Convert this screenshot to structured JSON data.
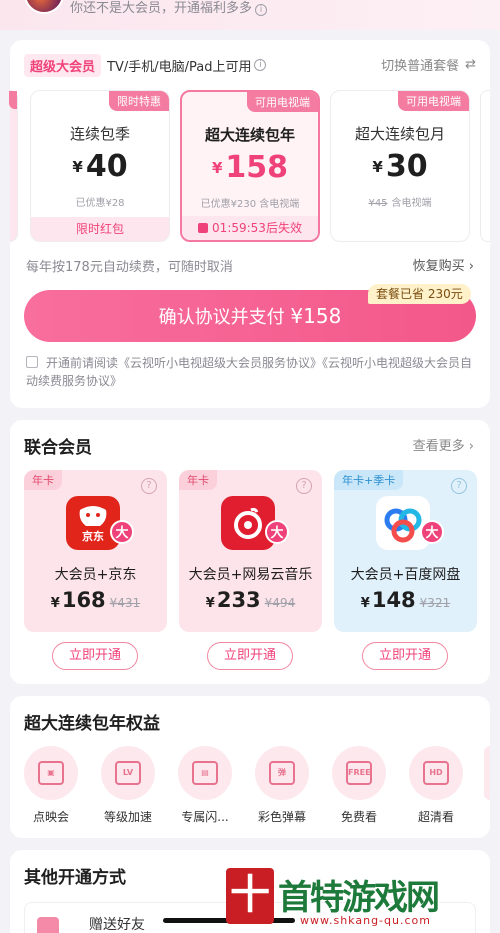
{
  "header": {
    "promo_text": "你还不是大会员，开通福利多多",
    "info_icon": "ⓘ"
  },
  "packages": {
    "svip_tag": "超级大会员",
    "devices_text": "TV/手机/电脑/Pad上可用",
    "info_icon": "ⓘ",
    "switch_label": "切换普通套餐",
    "switch_icon": "⇄",
    "plans": [
      {
        "badge": "限时特惠",
        "name": "连续包季",
        "currency": "¥",
        "price": "40",
        "sub": "已优惠¥28",
        "sub_strike": "",
        "footer": "限时红包",
        "selected": false
      },
      {
        "badge": "可用电视端",
        "name": "超大连续包年",
        "currency": "¥",
        "price": "158",
        "sub": "已优惠¥230  含电视端",
        "sub_strike": "",
        "footer": "01:59:53后失效",
        "selected": true
      },
      {
        "badge": "可用电视端",
        "name": "超大连续包月",
        "currency": "¥",
        "price": "30",
        "sub": "含电视端",
        "sub_strike": "¥45",
        "footer": "",
        "selected": false
      }
    ],
    "renew_note": "每年按178元自动续费，可随时取消",
    "restore_label": "恢复购买 ›",
    "pay_label": "确认协议并支付",
    "pay_amount": "¥158",
    "saved_tag": "套餐已省 230元",
    "agreement": "开通前请阅读《云视听小电视超级大会员服务协议》《云视听小电视超级大会员自动续费服务协议》"
  },
  "joint": {
    "title": "联合会员",
    "see_more": "查看更多 ›",
    "items": [
      {
        "tag": "年卡",
        "logo_text": "京东",
        "big_badge": "大",
        "name": "大会员+京东",
        "currency": "¥",
        "price": "168",
        "original": "¥431",
        "button": "立即开通",
        "theme": "pink"
      },
      {
        "tag": "年卡",
        "logo_text": "",
        "big_badge": "大",
        "name": "大会员+网易云音乐",
        "currency": "¥",
        "price": "233",
        "original": "¥494",
        "button": "立即开通",
        "theme": "pink"
      },
      {
        "tag": "年卡+季卡",
        "logo_text": "",
        "big_badge": "大",
        "name": "大会员+百度网盘",
        "currency": "¥",
        "price": "148",
        "original": "¥321",
        "button": "立即开通",
        "theme": "blue"
      }
    ]
  },
  "benefits": {
    "title": "超大连续包年权益",
    "items": [
      {
        "label": "点映会",
        "icon": "cinema-icon",
        "glyph": "▣"
      },
      {
        "label": "等级加速",
        "icon": "level-up-icon",
        "glyph": "LV"
      },
      {
        "label": "专属闪...",
        "icon": "flash-icon",
        "glyph": "▤"
      },
      {
        "label": "彩色弹幕",
        "icon": "danmaku-icon",
        "glyph": "弹"
      },
      {
        "label": "免费看",
        "icon": "free-icon",
        "glyph": "FREE"
      },
      {
        "label": "超清看",
        "icon": "hd-icon",
        "glyph": "HD"
      }
    ]
  },
  "other": {
    "title": "其他开通方式",
    "gift_label": "赠送好友"
  },
  "watermark": {
    "char": "十",
    "text": "首特游戏网",
    "url": "www.shkang-qu.com"
  },
  "colors": {
    "accent": "#f0427a",
    "accent_light": "#fde6ee",
    "saved_bg": "#fff1c9"
  }
}
